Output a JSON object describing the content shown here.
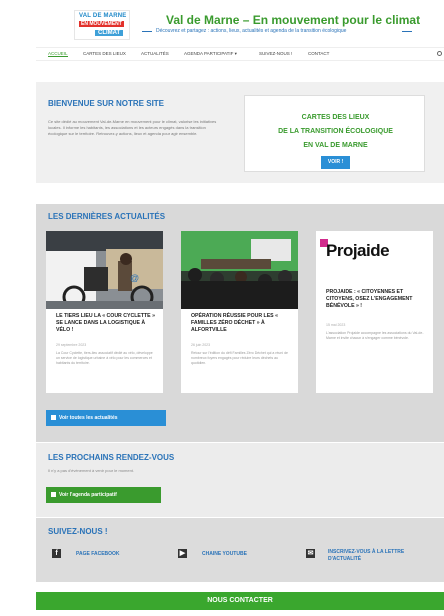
{
  "header": {
    "logo": {
      "line1": "VAL DE MARNE",
      "line2": "EN MOUVEMENT",
      "line3": "CLIMAT"
    },
    "title": "Val de Marne – En mouvement pour le climat",
    "subtitle": "Découvrez et partagez : actions, lieux, actualités et agenda de la transition écologique"
  },
  "nav": {
    "items": [
      {
        "label": "Accueil",
        "active": true
      },
      {
        "label": "Cartes des lieux"
      },
      {
        "label": "Actualités"
      },
      {
        "label": "Agenda participatif ▾"
      },
      {
        "label": "Suivez-nous !"
      },
      {
        "label": "Contact"
      }
    ]
  },
  "welcome": {
    "title": "Bienvenue sur notre site",
    "text": "Ce site dédié au mouvement Val-de-Marne en mouvement pour le climat, valorise les initiatives locales. Il informe les habitants, les associations et les acteurs engagés dans la transition écologique sur le territoire. Retrouvez-y actions, lieux et agenda pour agir ensemble.",
    "cards_box": {
      "line1": "CARTES DES LIEUX",
      "line2": "DE LA TRANSITION ÉCOLOGIQUE",
      "line3": "EN VAL DE MARNE",
      "button": "VOIR !"
    }
  },
  "news": {
    "title": "Les dernières actualités",
    "cards": [
      {
        "title": "LE TIERS LIEU LA « COUR CYCLETTE » SE LANCE DANS LA LOGISTIQUE À VÉLO !",
        "date": "29 septembre 2023",
        "excerpt": "La Cour Cyclette, tiers-lieu associatif dédié au vélo, développe un service de logistique urbaine à vélo pour les commerces et habitants du territoire."
      },
      {
        "title": "OPÉRATION RÉUSSIE POUR LES « FAMILLES ZÉRO DÉCHET » À ALFORTVILLE",
        "date": "26 juin 2023",
        "excerpt": "Retour sur l'édition du défi Familles Zéro Déchet qui a réuni de nombreux foyers engagés pour réduire leurs déchets au quotidien."
      },
      {
        "title": "PROJAIDE : « CITOYENNES ET CITOYENS, OSEZ L'ENGAGEMENT BÉNÉVOLE » !",
        "date": "15 mai 2023",
        "excerpt": "L'association Projaide accompagne les associations du Val-de-Marne et invite chacun à s'engager comme bénévole.",
        "logo_text": "Projaide"
      }
    ],
    "button": "Voir toutes les actualités"
  },
  "events": {
    "title": "Les prochains rendez-vous",
    "text": "Il n'y a pas d'événement à venir pour le moment.",
    "button": "Voir l'agenda participatif"
  },
  "follow": {
    "title": "Suivez-nous !",
    "links": [
      {
        "label": "PAGE FACEBOOK",
        "icon": "facebook-icon"
      },
      {
        "label": "CHAINE YOUTUBE",
        "icon": "youtube-icon"
      },
      {
        "label": "INSCRIVEZ-VOUS À LA LETTRE D'ACTUALITÉ",
        "icon": "newsletter-icon"
      }
    ]
  },
  "contact": {
    "label": "Nous contacter"
  },
  "colors": {
    "green": "#3a9b2e",
    "blue": "#2a73b8",
    "button_blue": "#2a8fd6"
  }
}
